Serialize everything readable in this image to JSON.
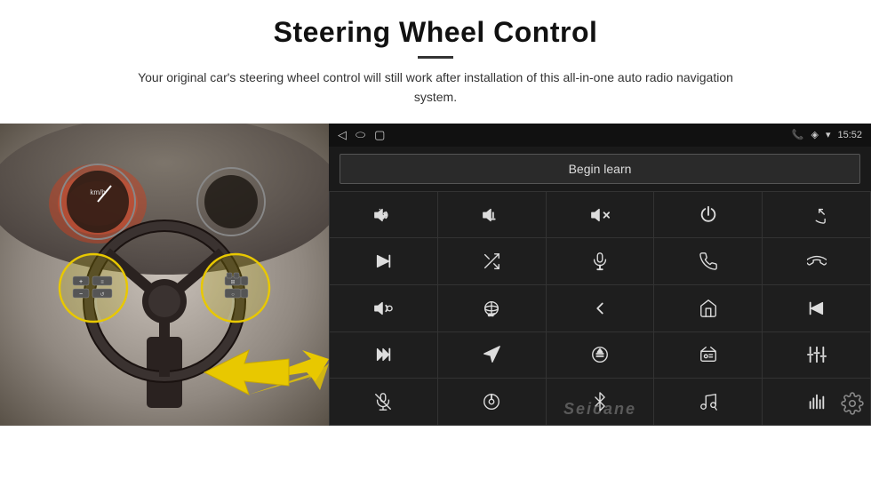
{
  "header": {
    "title": "Steering Wheel Control",
    "subtitle": "Your original car's steering wheel control will still work after installation of this all-in-one auto radio navigation system."
  },
  "status_bar": {
    "time": "15:52",
    "nav_back": "◁",
    "nav_home": "⬭",
    "nav_square": "▢"
  },
  "begin_learn_btn": "Begin learn",
  "icon_grid": [
    {
      "row": 1,
      "icons": [
        "vol_up",
        "vol_down",
        "mute",
        "power",
        "prev_track_phone"
      ]
    },
    {
      "row": 2,
      "icons": [
        "next_track",
        "shuffle",
        "mic",
        "phone",
        "hang_up"
      ]
    },
    {
      "row": 3,
      "icons": [
        "speaker",
        "camera_360",
        "back_arrow",
        "home",
        "skip_back"
      ]
    },
    {
      "row": 4,
      "icons": [
        "fast_forward",
        "navigate",
        "eject_circle",
        "radio",
        "equalizer"
      ]
    },
    {
      "row": 5,
      "icons": [
        "mic2",
        "settings_knob",
        "bluetooth",
        "music_note",
        "bars"
      ]
    }
  ],
  "watermark": "Seicane",
  "gear_icon_label": "settings"
}
